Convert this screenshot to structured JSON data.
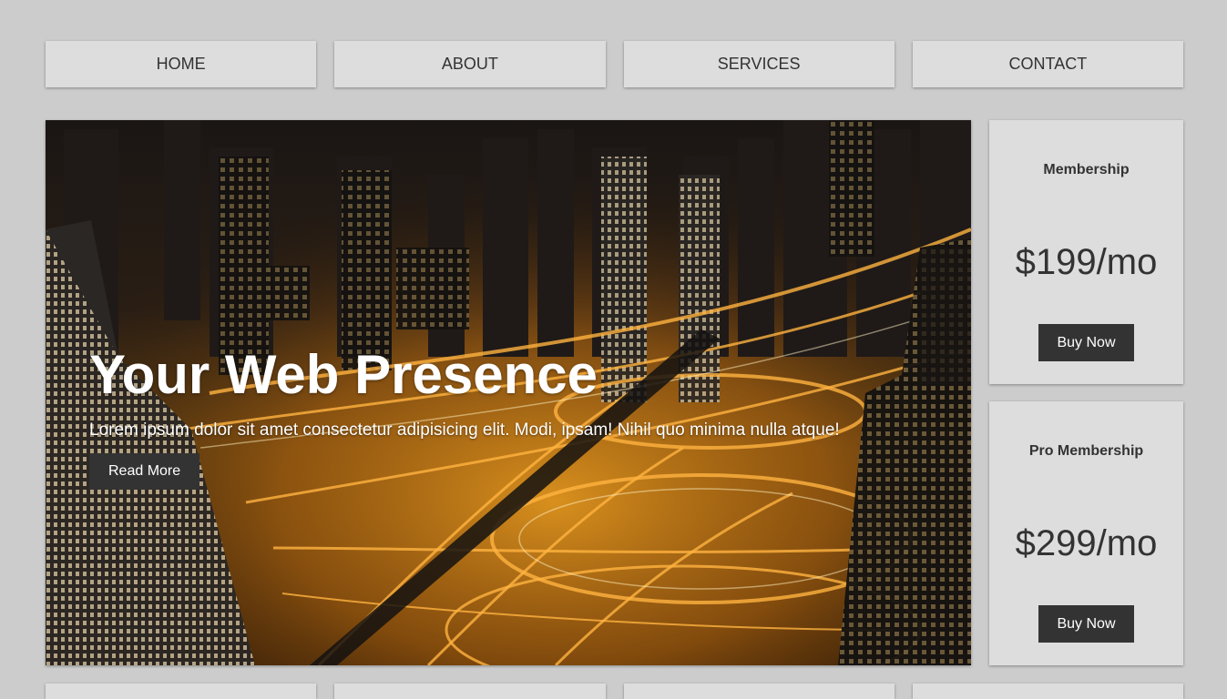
{
  "nav": {
    "items": [
      {
        "label": "HOME"
      },
      {
        "label": "ABOUT"
      },
      {
        "label": "SERVICES"
      },
      {
        "label": "CONTACT"
      }
    ]
  },
  "hero": {
    "title": "Your Web Presence",
    "text": "Lorem ipsum dolor sit amet consectetur adipisicing elit. Modi, ipsam! Nihil quo minima nulla atque!",
    "button_label": "Read More",
    "image": "night-city-highway-photo"
  },
  "plans": [
    {
      "name": "Membership",
      "price": "$199/mo",
      "button_label": "Buy Now"
    },
    {
      "name": "Pro Membership",
      "price": "$299/mo",
      "button_label": "Buy Now"
    }
  ],
  "colors": {
    "page_background": "#cccccc",
    "card_background": "#dddddd",
    "button_background": "#333333",
    "text_dark": "#333333",
    "text_light": "#ffffff"
  }
}
